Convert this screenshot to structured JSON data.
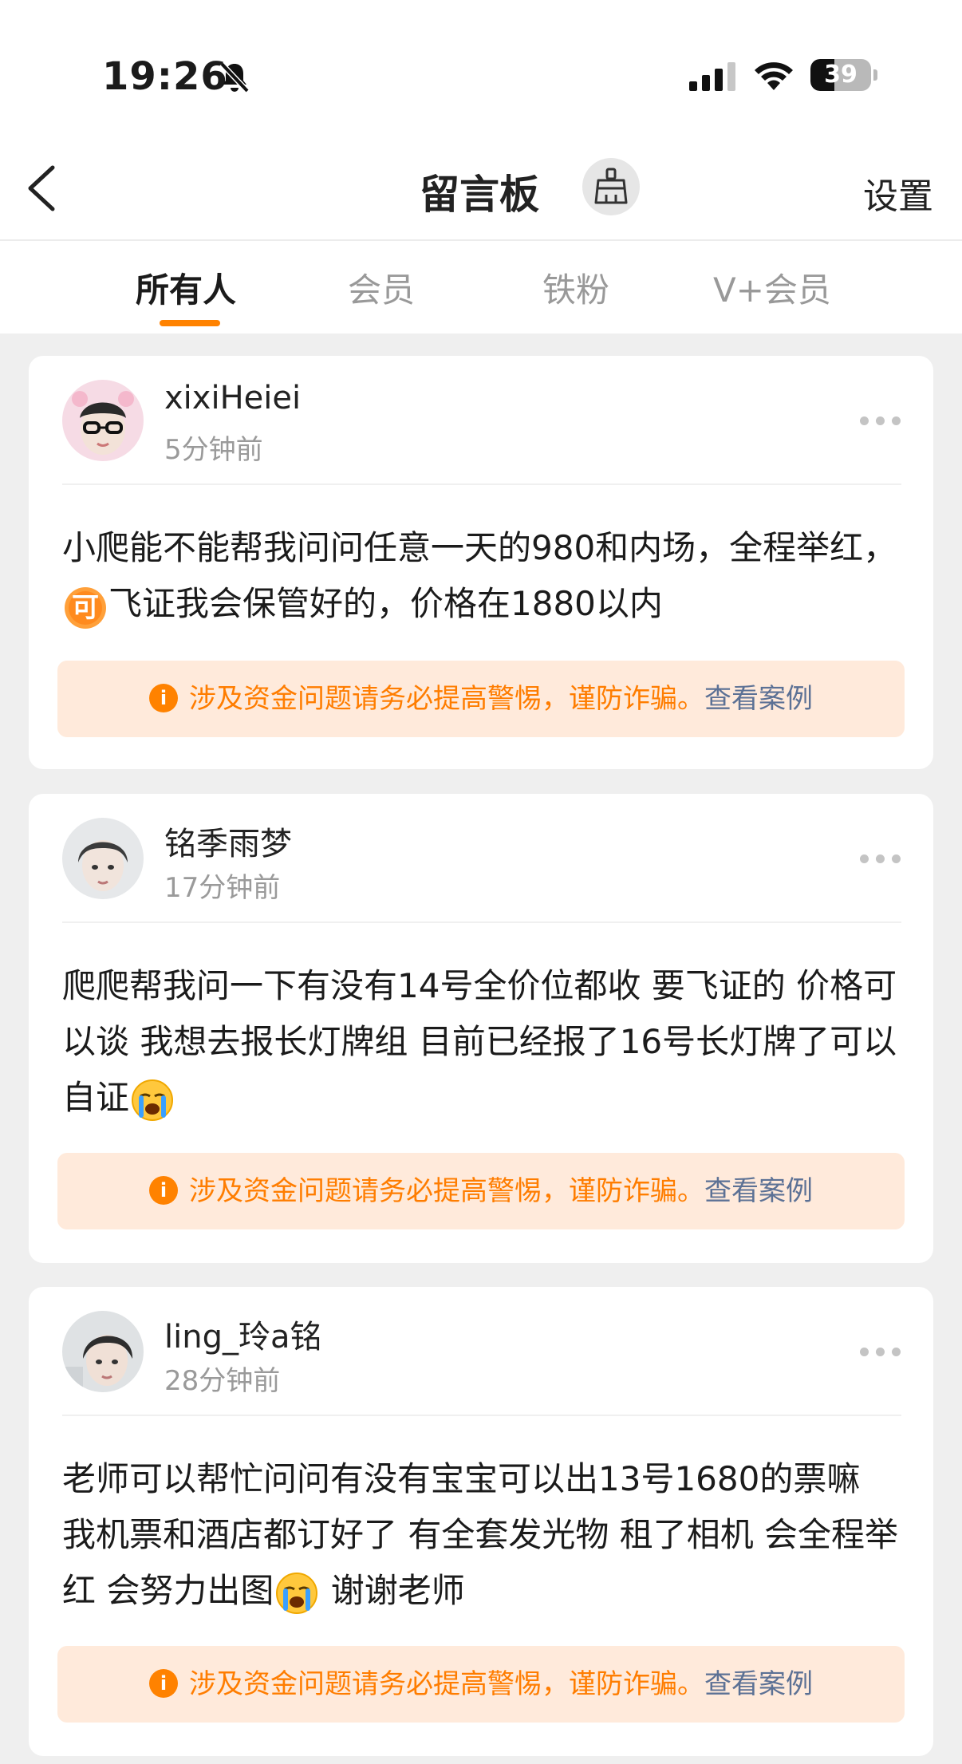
{
  "status": {
    "time": "19:26",
    "battery": "39",
    "battery_level_percent": 39
  },
  "nav": {
    "title": "留言板",
    "settings": "设置"
  },
  "tabs": [
    {
      "label": "所有人",
      "active": true
    },
    {
      "label": "会员",
      "active": false
    },
    {
      "label": "铁粉",
      "active": false
    },
    {
      "label": "V+会员",
      "active": false
    }
  ],
  "colors": {
    "accent": "#ff8200",
    "warning_text": "#ff7d00",
    "warning_bg": "#ffeadb",
    "link": "#5c7195"
  },
  "messages": [
    {
      "user": "xixiHeiei",
      "time": "5分钟前",
      "text_before_badge": "小爬能不能帮我问问任意一天的980和内场，全程举红，",
      "badge": "可",
      "text_after_badge": "飞证我会保管好的，价格在1880以内",
      "warning": "涉及资金问题请务必提高警惕，谨防诈骗。",
      "warning_link": "查看案例"
    },
    {
      "user": "铭季雨梦",
      "time": "17分钟前",
      "text_before_emoji": "爬爬帮我问一下有没有14号全价位都收 要飞证的 价格可以谈 我想去报长灯牌组 目前已经报了16号长灯牌了可以自证",
      "emoji": "crying-face-icon",
      "warning": "涉及资金问题请务必提高警惕，谨防诈骗。",
      "warning_link": "查看案例"
    },
    {
      "user": "ling_玲a铭",
      "time": "28分钟前",
      "text_before_emoji": "老师可以帮忙问问有没有宝宝可以出13号1680的票嘛 我机票和酒店都订好了 有全套发光物 租了相机 会全程举红 会努力出图",
      "emoji": "crying-face-icon",
      "text_after_emoji": " 谢谢老师",
      "warning": "涉及资金问题请务必提高警惕，谨防诈骗。",
      "warning_link": "查看案例"
    }
  ]
}
